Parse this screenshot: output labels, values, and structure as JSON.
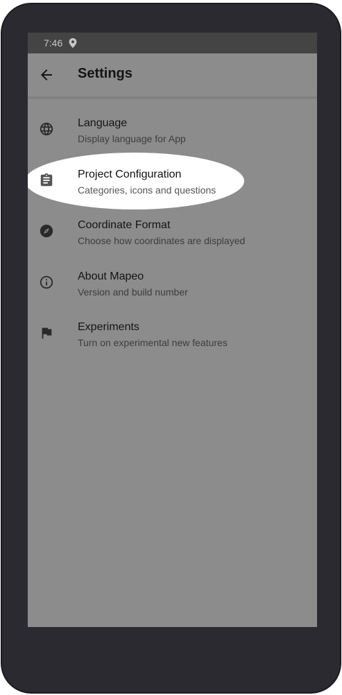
{
  "status_bar": {
    "time": "7:46",
    "icons": [
      "location-pin-icon"
    ]
  },
  "app_bar": {
    "back_icon": "arrow-back-icon",
    "title": "Settings"
  },
  "settings": {
    "items": [
      {
        "icon": "globe-icon",
        "title": "Language",
        "subtitle": "Display language for App"
      },
      {
        "icon": "clipboard-icon",
        "title": "Project Configuration",
        "subtitle": "Categories, icons and questions",
        "highlighted": true
      },
      {
        "icon": "compass-icon",
        "title": "Coordinate Format",
        "subtitle": "Choose how coordinates are displayed"
      },
      {
        "icon": "info-icon",
        "title": "About Mapeo",
        "subtitle": "Version and build number"
      },
      {
        "icon": "flag-icon",
        "title": "Experiments",
        "subtitle": "Turn on experimental new features"
      }
    ]
  },
  "colors": {
    "device_frame": "#2b2a30",
    "screen_overlay": "#8c8c8c",
    "status_bar": "#444444",
    "highlight": "#ffffff"
  }
}
